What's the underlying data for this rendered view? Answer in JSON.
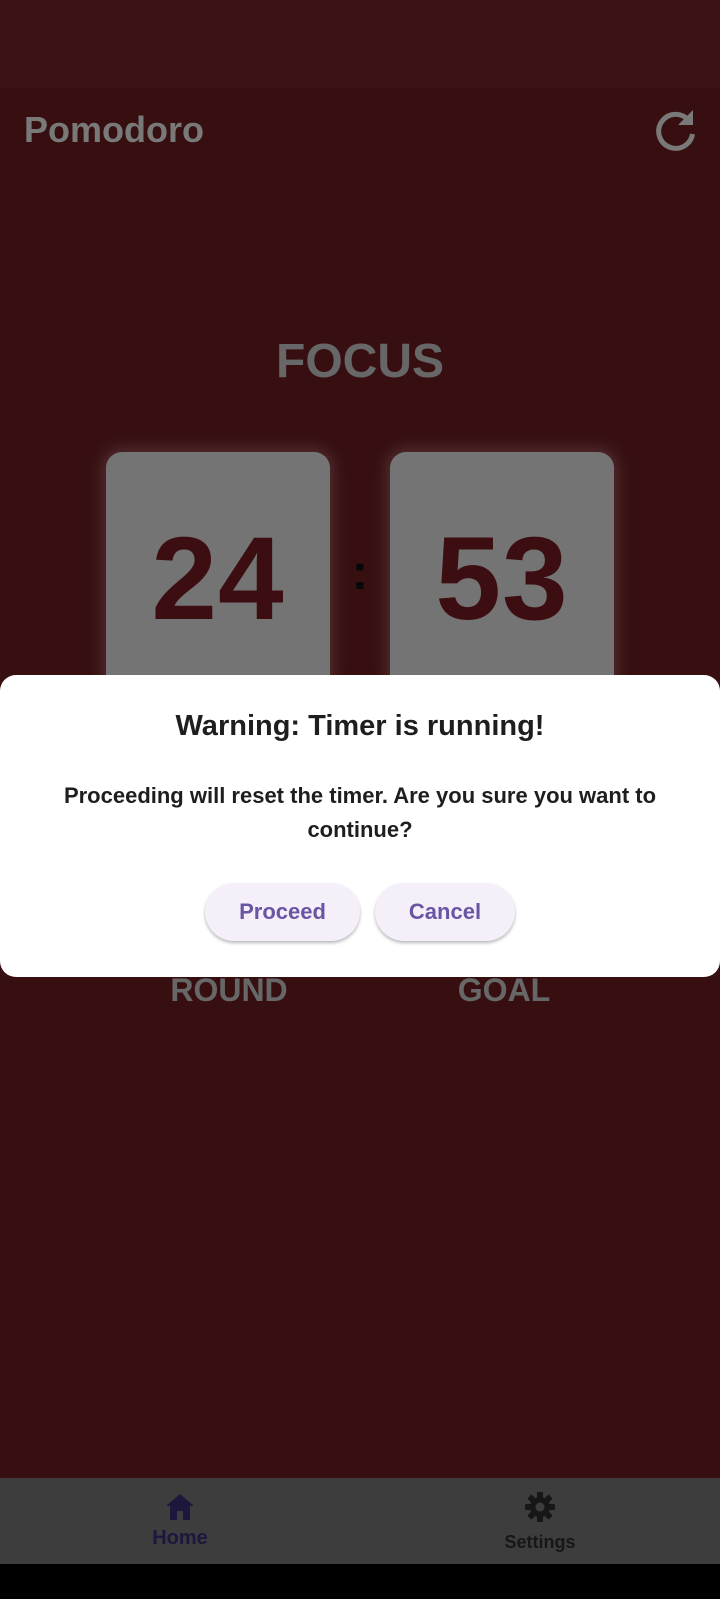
{
  "app": {
    "title": "Pomodoro",
    "refresh_icon": "refresh-icon"
  },
  "timer": {
    "mode": "FOCUS",
    "minutes": "24",
    "separator": ":",
    "seconds": "53"
  },
  "stats": {
    "round_label": "ROUND",
    "goal_label": "GOAL"
  },
  "bottom_nav": {
    "items": [
      {
        "label": "Home",
        "icon": "home-icon",
        "selected": true
      },
      {
        "label": "Settings",
        "icon": "gear-icon",
        "selected": false
      }
    ]
  },
  "dialog": {
    "title": "Warning: Timer is running!",
    "message": "Proceeding will reset the timer. Are you sure you want to continue?",
    "proceed_label": "Proceed",
    "cancel_label": "Cancel"
  },
  "colors": {
    "app_background": "#6f1f23",
    "status_bar": "#7a2529",
    "card": "#e9e9e9",
    "digits": "#7a1d22",
    "dialog_button_text": "#6a55a4",
    "dialog_button_bg": "#f4eff8",
    "nav_selected": "#3b2c7a"
  }
}
